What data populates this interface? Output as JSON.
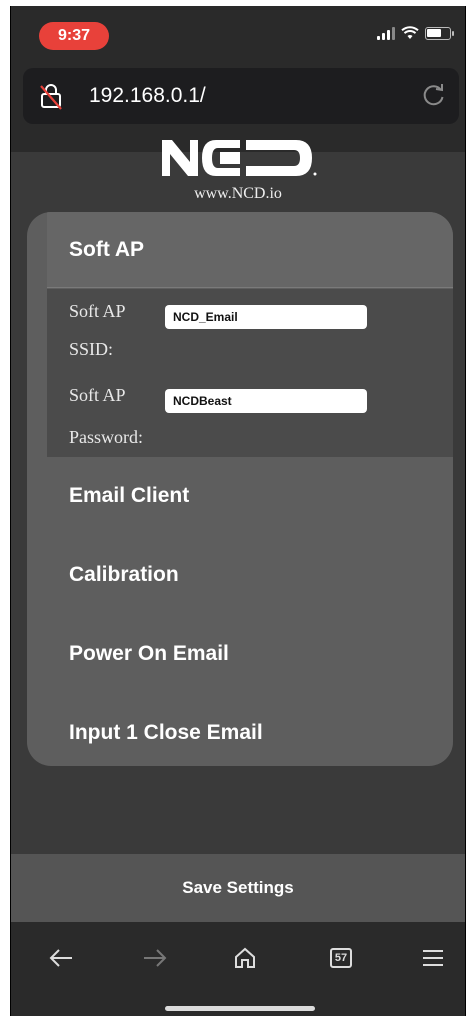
{
  "status_bar": {
    "time": "9:37",
    "time_pill_color": "#e8413a"
  },
  "browser": {
    "url": "192.168.0.1/",
    "tabs_count": "57"
  },
  "logo": {
    "mark": "NCD",
    "url": "www.NCD.io"
  },
  "sections": {
    "soft_ap": {
      "title": "Soft AP",
      "ssid_label_1": "Soft AP",
      "ssid_label_2": "SSID:",
      "ssid_value": "NCD_Email",
      "password_label_1": "Soft AP",
      "password_label_2": "Password:",
      "password_value": "NCDBeast"
    },
    "email_client": {
      "title": "Email Client"
    },
    "calibration": {
      "title": "Calibration"
    },
    "power_on_email": {
      "title": "Power On Email"
    },
    "input1_close_email": {
      "title": "Input 1 Close Email"
    }
  },
  "save_button": {
    "label": "Save Settings"
  },
  "icons": {
    "lock": "lock-slash-icon",
    "reload": "reload-icon",
    "back": "arrow-left-icon",
    "forward": "arrow-right-icon",
    "home": "home-icon",
    "tabs": "tabs-icon",
    "menu": "hamburger-menu-icon"
  }
}
